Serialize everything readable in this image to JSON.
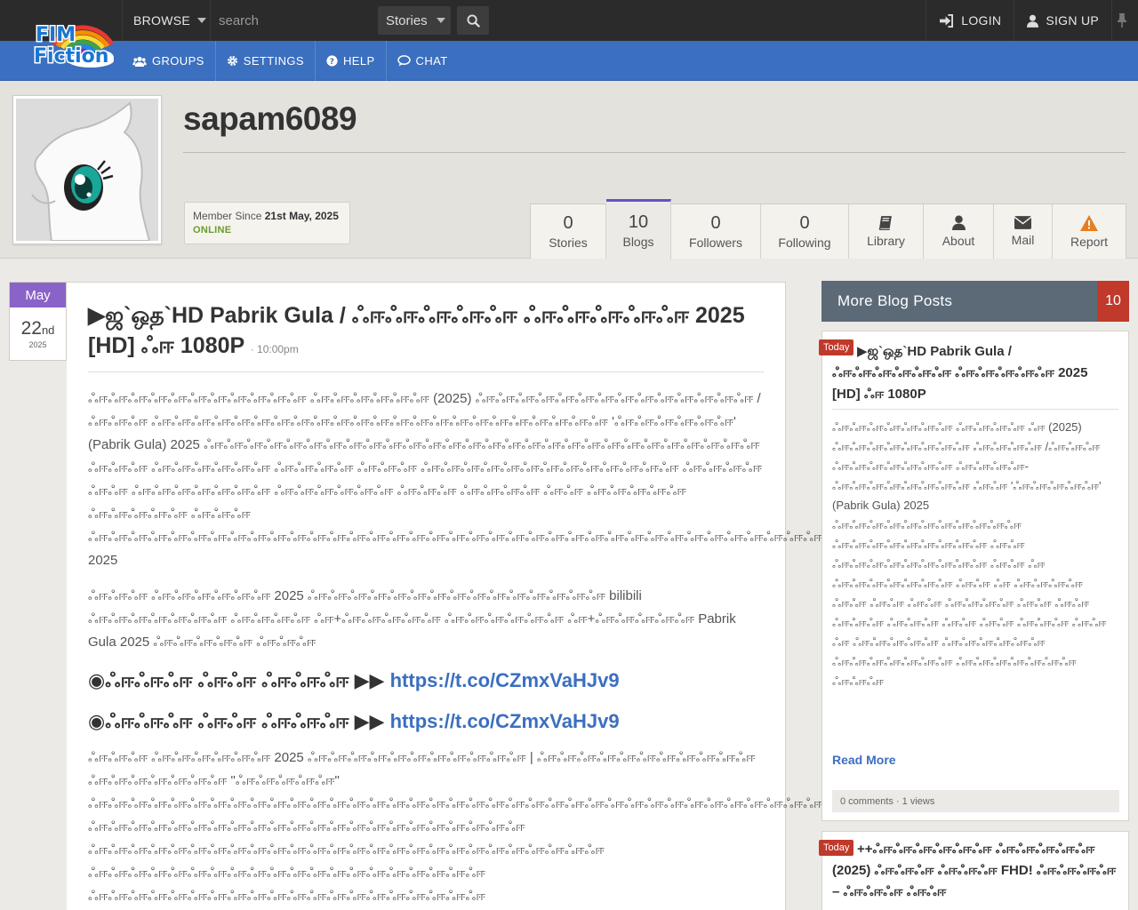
{
  "topbar": {
    "logo_line1": "FIM",
    "logo_line2": "Fiction",
    "browse": "BROWSE",
    "search_placeholder": "search",
    "search_type": "Stories",
    "login": "LOGIN",
    "signup": "SIGN UP"
  },
  "nav": {
    "groups": "GROUPS",
    "settings": "SETTINGS",
    "help": "HELP",
    "chat": "CHAT"
  },
  "profile": {
    "username": "sapam6089",
    "member_since_label": "Member Since",
    "member_since_date": "21st May, 2025",
    "status": "ONLINE"
  },
  "tabs": {
    "stories": {
      "count": "0",
      "label": "Stories"
    },
    "blogs": {
      "count": "10",
      "label": "Blogs"
    },
    "followers": {
      "count": "0",
      "label": "Followers"
    },
    "following": {
      "count": "0",
      "label": "Following"
    },
    "library": {
      "label": "Library"
    },
    "about": {
      "label": "About"
    },
    "mail": {
      "label": "Mail"
    },
    "report": {
      "label": "Report"
    }
  },
  "date_badge": {
    "month": "May",
    "day": "22",
    "suffix": "nd",
    "year": "2025"
  },
  "post": {
    "title": "▶ஜ`ஒத`HD Pabrik Gula / ஃஈஃஈஃஈஃஈஃஈ ஃஈஃஈஃஈஃஈஃஈ 2025 [HD] ஃஈ 1080P",
    "time": "· 10:00pm",
    "para1_a": "ஃஈஃஈஃஈஃஈஃஈஃஈஃஈஃஈஃஈஃஈஃஈ ஃஈஃஈஃஈஃஈஃஈஃஈ (2025) ஃஈஃஈஃஈஃஈஃஈஃஈஃஈஃஈஃஈஃஈஃஈஃஈஃஈஃஈ /ஃஈஃஈஃஈ ஃஈஃஈஃஈஃஈஃஈஃஈஃஈஃஈஃஈஃஈஃஈஃஈஃஈஃஈஃஈஃஈஃஈஃஈஃஈஃஈஃஈஃஈஃஈ 'ஃஈஃஈஃஈஃஈஃஈஃஈ' (Pabrik Gula)",
    "para1_b": "2025 ஃஈஃஈஃஈஃஈஃஈஃஈஃஈஃஈஃஈஃஈஃஈஃஈஃஈஃஈஃஈஃஈஃஈஃஈஃஈஃஈஃஈஃஈஃஈஃஈஃஈஃஈஃஈஃஈ ஃஈஃஈஃஈ ஃஈஃஈஃஈஃஈஃஈஃஈ ஃஈஃஈஃஈஃஈ ஃஈஃஈஃஈ ஃஈஃஈஃஈஃஈஃஈஃஈஃஈஃஈஃஈஃஈஃஈஃஈஃஈ ஃஈஃஈஃஈஃஈ ஃஈஃஈ ஃஈஃஈஃஈஃஈஃஈஃஈஃஈ ஃஈஃஈஃஈஃஈஃஈஃஈ ஃஈஃஈஃஈ ஃஈஃஈஃஈஃஈ ஃஈஃஈ ஃஈஃஈஃஈஃஈஃஈ ஃஈஃஈஃஈஃஈஃஈ ஃஈஃஈஃஈ ஃஈஃஈஃஈஃஈஃஈஃஈஃஈஃஈஃஈஃஈஃஈஃஈஃஈஃஈஃஈஃஈஃஈஃஈஃஈஃஈஃஈஃஈஃஈஃஈஃஈஃஈஃஈஃஈஃஈஃஈஃஈஃஈஃஈஃஈஃஈஃஈஃஈஃஈ 2025",
    "para2_a": "ஃஈஃஈஃஈ ஃஈஃஈஃஈஃஈஃஈஃஈ 2025 ஃஈஃஈஃஈஃஈஃஈஃஈஃஈஃஈஃஈஃஈஃஈஃஈஃஈஃஈஃஈ bilibili ஃஈஃஈஃஈஃஈஃஈஃஈஃஈ ஃஈஃஈஃஈஃஈ ஃஈ+ஃஈஃஈஃஈஃஈஃஈ ஃஈஃஈஃஈஃஈஃஈஃஈ ஃஈ+ஃஈஃஈஃஈஃஈஃஈ",
    "para2_b": "Pabrik Gula 2025 ஃஈஃஈஃஈஃஈஃஈ ஃஈஃஈஃஈ",
    "link_label": "◉ஃஈஃஈஃஈ ஃஈஃஈ ஃஈஃஈஃஈ ▶▶",
    "link_url": "https://t.co/CZmxVaHJv9",
    "para3_a": "ஃஈஃஈஃஈ ஃஈஃஈஃஈஃஈஃஈஃஈ 2025 ஃஈஃஈஃஈஃஈஃஈஃஈஃஈஃஈஃஈஃஈஃஈ |",
    "para3_b": "ஃஈஃஈஃஈஃஈஃஈஃஈஃஈஃஈஃஈஃஈஃஈ ஃஈஃஈஃஈஃஈஃஈஃஈஃஈ \"ஃஈஃஈஃஈஃஈஃஈ\" ஃஈஃஈஃஈஃஈஃஈஃஈஃஈஃஈஃஈஃஈஃஈஃஈஃஈஃஈஃஈஃஈஃஈஃஈஃஈஃஈஃஈஃஈஃஈஃஈஃஈஃஈஃஈஃஈஃஈஃஈஃஈஃஈஃஈஃஈஃஈஃஈஃஈஃஈஃஈஃஈஃஈஃஈஃஈ ஃஈஃஈஃஈஃஈஃஈஃஈஃஈஃஈஃஈஃஈஃஈஃஈஃஈஃஈஃஈஃஈஃஈஃஈஃஈஃஈஃஈஃஈ ஃஈஃஈஃஈஃஈஃஈஃஈஃஈஃஈஃஈஃஈஃஈஃஈஃஈஃஈஃஈஃஈஃஈஃஈஃஈஃஈஃஈஃஈஃஈஃஈஃஈஃஈ ஃஈஃஈஃஈஃஈஃஈஃஈஃஈஃஈஃஈஃஈஃஈஃஈஃஈஃஈஃஈஃஈஃஈஃஈஃஈஃஈ ஃஈஃஈஃஈஃஈஃஈஃஈஃஈஃஈஃஈஃஈஃஈஃஈஃஈஃஈஃஈஃஈஃஈஃஈஃஈஃஈ"
  },
  "sidebar": {
    "title": "More Blog Posts",
    "count": "10",
    "today_label": "Today",
    "card1_title": "▶ஜ`ஒத`HD Pabrik Gula / ஃஈஃஈஃஈஃஈஃஈஃஈ ஃஈஃஈஃஈஃஈஃஈ 2025 [HD] ஃஈ 1080P",
    "card1_body": "ஃஈஃஈஃஈஃஈஃஈஃஈஃஈ ஃஈஃஈஃஈஃஈ ஃஈ (2025) ஃஈஃஈஃஈஃஈஃஈஃஈஃஈஃஈ ஃஈஃஈஃஈஃஈ /ஃஈஃஈஃஈ ஃஈஃஈஃஈஃஈஃஈஃஈஃஈ ஃஈஃஈஃஈஃஈ-ஃஈஃஈஃஈஃஈஃஈஃஈஃஈஃஈ ஃஈஃஈ 'ஃஈஃஈஃஈஃஈஃஈ' (Pabrik Gula) 2025 ஃஈஃஈஃஈஃஈஃஈஃஈஃஈஃஈஃஈஃஈஃஈ ஃஈஃஈஃஈஃஈஃஈஃஈஃஈஃஈஃஈ ஃஈஃஈ ஃஈஃஈஃஈஃஈஃஈஃஈஃஈஃஈஃஈ ஃஈஃஈ ஃஈ ஃஈஃஈஃஈஃஈஃஈஃஈஃஈ ஃஈஃஈ ஃஈ ஃஈஃஈஃஈஃஈ ஃஈஃஈ ஃஈஃஈ ஃஈஃஈ ஃஈஃஈஃஈஃஈ ஃஈஃஈ ஃஈஃஈ ஃஈஃஈஃஈ ஃஈஃஈஃஈ ஃஈஃஈ ஃஈஃஈ ஃஈஃஈஃஈ ஃஈஃஈ ஃஈ ஃஈஃஈஃஈஃஈஃஈ ஃஈஃஈஃஈஃஈஃஈஃஈ ஃஈஃஈஃஈஃஈஃஈஃஈஃஈ ஃஈஃஈஃஈஃஈஃஈஃஈஃஈ ஃஈஃஈஃஈ",
    "read_more": "Read More",
    "card1_footer": "0 comments · 1 views",
    "card2_title": "++ஃஈஃஈஃஈஃஈஃஈஃஈ ஃஈஃஈஃஈஃஈஃஈ (2025) ஃஈஃஈஃஈ ஃஈஃஈஃஈ FHD! ஃஈஃஈஃஈஃஈ – ஃஈஃஈஃஈ ஃஈஃஈ"
  },
  "colors": {
    "topbar": "#2b2b2b",
    "navbar": "#3b6fbf",
    "accent_purple": "#8a63c8",
    "link_blue": "#3b6fbf",
    "badge_red": "#c0392b",
    "online_green": "#6b9b2e"
  }
}
